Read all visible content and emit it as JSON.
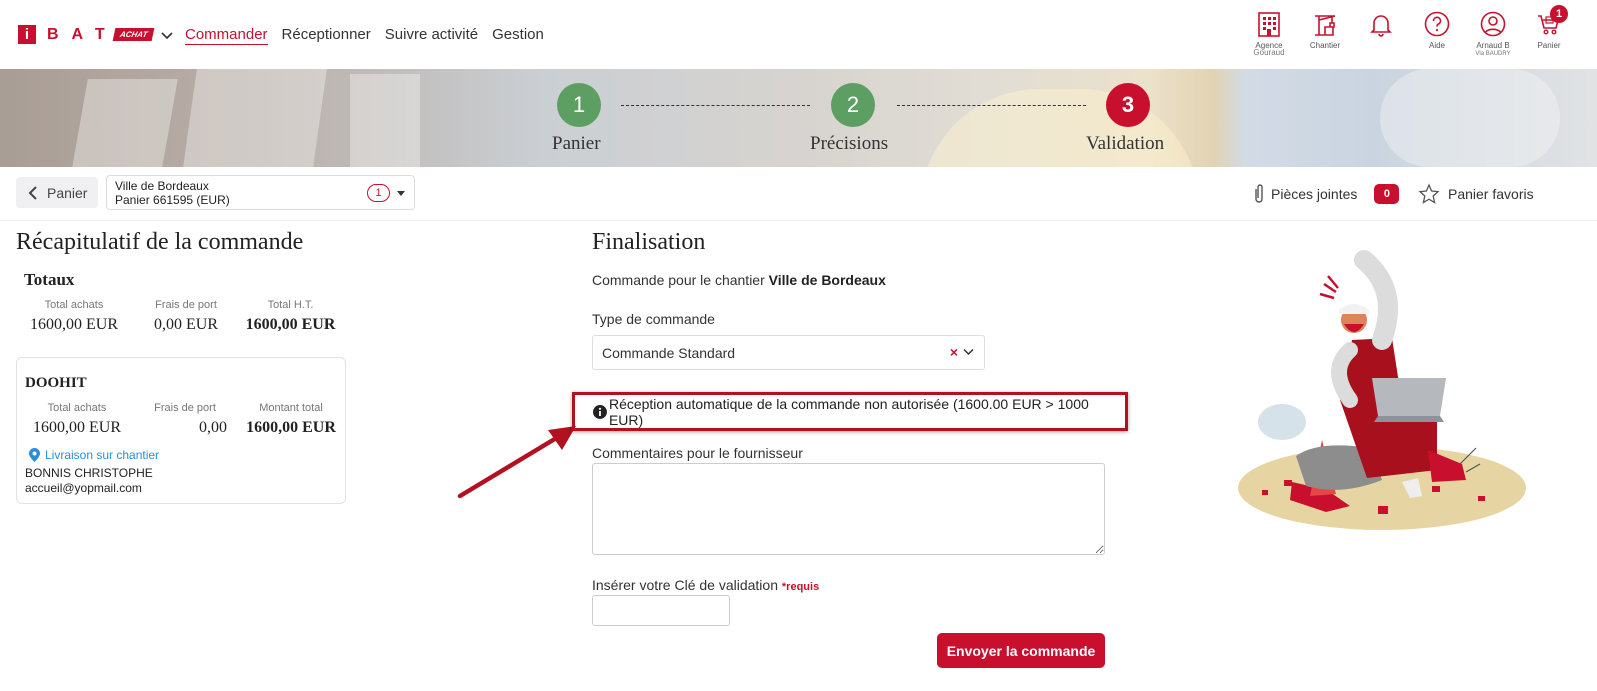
{
  "brand": {
    "logo_letters": "BAT",
    "logo_i": "i",
    "logo_tag": "ACHAT"
  },
  "nav": [
    {
      "label": "Commander",
      "active": true
    },
    {
      "label": "Réceptionner",
      "active": false
    },
    {
      "label": "Suivre activité",
      "active": false
    },
    {
      "label": "Gestion",
      "active": false
    }
  ],
  "top_icons": {
    "agence": {
      "label": "Agence",
      "sub": "Gouraud",
      "icon": "building-icon"
    },
    "chantier": {
      "label": "Chantier",
      "icon": "crane-icon"
    },
    "notifications": {
      "icon": "bell-icon"
    },
    "aide": {
      "label": "Aide",
      "icon": "help-icon"
    },
    "user": {
      "label": "Arnaud B",
      "sub": "Vla BAUDRY",
      "icon": "user-icon"
    },
    "panier": {
      "label": "Panier",
      "badge": "1",
      "icon": "cart-icon"
    }
  },
  "steps": [
    {
      "num": "1",
      "label": "Panier",
      "state": "done"
    },
    {
      "num": "2",
      "label": "Précisions",
      "state": "done"
    },
    {
      "num": "3",
      "label": "Validation",
      "state": "current"
    }
  ],
  "subbar": {
    "back_label": "Panier",
    "cart_name": "Ville de Bordeaux",
    "cart_id": "Panier 661595 (EUR)",
    "cart_count": "1",
    "attachments_label": "Pièces jointes",
    "attachments_count": "0",
    "favorites_label": "Panier favoris"
  },
  "recap": {
    "title": "Récapitulatif de la commande",
    "totals_title": "Totaux",
    "totals": {
      "achats_label": "Total achats",
      "achats_value": "1600,00 EUR",
      "port_label": "Frais de port",
      "port_value": "0,00 EUR",
      "ht_label": "Total H.T.",
      "ht_value": "1600,00 EUR"
    },
    "supplier": {
      "name": "DOOHIT",
      "achats_label": "Total achats",
      "achats_value": "1600,00 EUR",
      "port_label": "Frais de port",
      "port_value": "0,00",
      "total_label": "Montant total",
      "total_value": "1600,00 EUR",
      "delivery_label": "Livraison sur chantier",
      "contact_name": "BONNIS CHRISTOPHE",
      "contact_email": "accueil@yopmail.com"
    }
  },
  "finalisation": {
    "title": "Finalisation",
    "chantier_prefix": "Commande pour le chantier",
    "chantier_name": "Ville de Bordeaux",
    "type_label": "Type de commande",
    "type_value": "Commande Standard",
    "warning_text": "Réception automatique de la commande non autorisée (1600.00 EUR > 1000 EUR)",
    "comment_label": "Commentaires pour le fournisseur",
    "comment_value": "",
    "key_label": "Insérer votre Clé de validation",
    "key_required": "*requis",
    "key_value": "",
    "submit_label": "Envoyer la commande"
  },
  "colors": {
    "brand_red": "#c8102e",
    "step_done": "#5d9e63",
    "link_blue": "#2a8fd6"
  }
}
